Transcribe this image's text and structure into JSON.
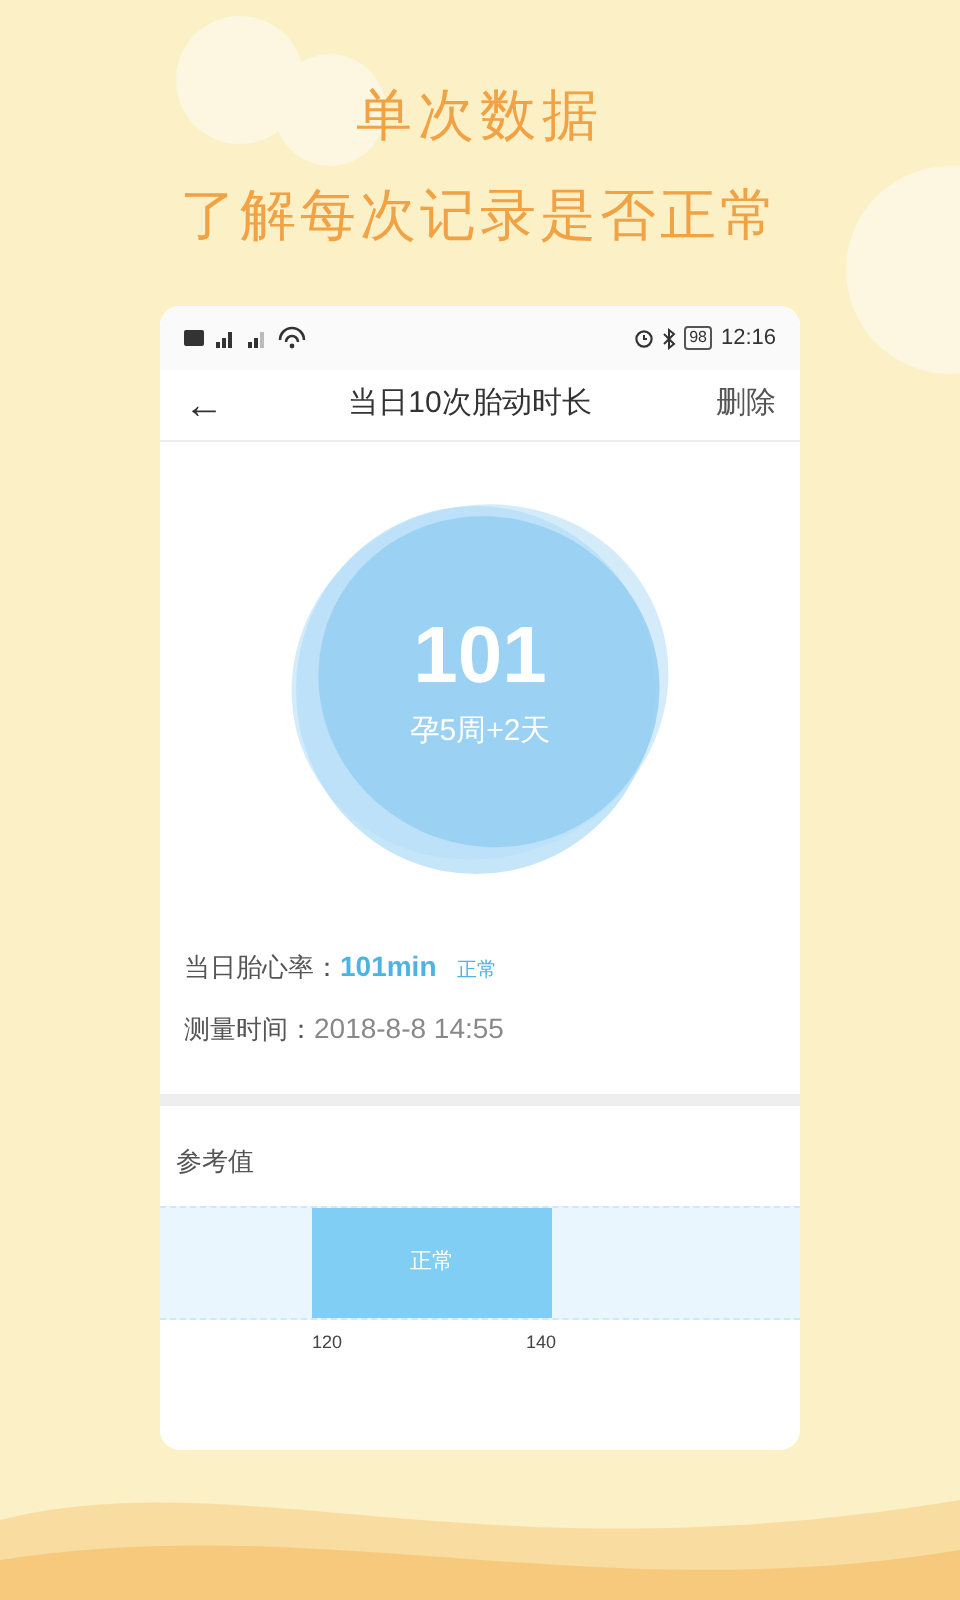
{
  "headline": {
    "title": "单次数据",
    "subtitle": "了解每次记录是否正常"
  },
  "status_bar": {
    "battery": "98",
    "time": "12:16"
  },
  "nav": {
    "back": "←",
    "title": "当日10次胎动时长",
    "action": "删除"
  },
  "summary": {
    "value": "101",
    "caption": "孕5周+2天"
  },
  "details": [
    {
      "label": "当日胎心率：",
      "value": "101min",
      "badge": "正常",
      "highlight": true
    },
    {
      "label": "测量时间：",
      "value": "2018-8-8  14:55",
      "highlight": false
    }
  ],
  "reference": {
    "title": "参考值",
    "band_label": "正常",
    "min_label": "120",
    "max_label": "140"
  }
}
